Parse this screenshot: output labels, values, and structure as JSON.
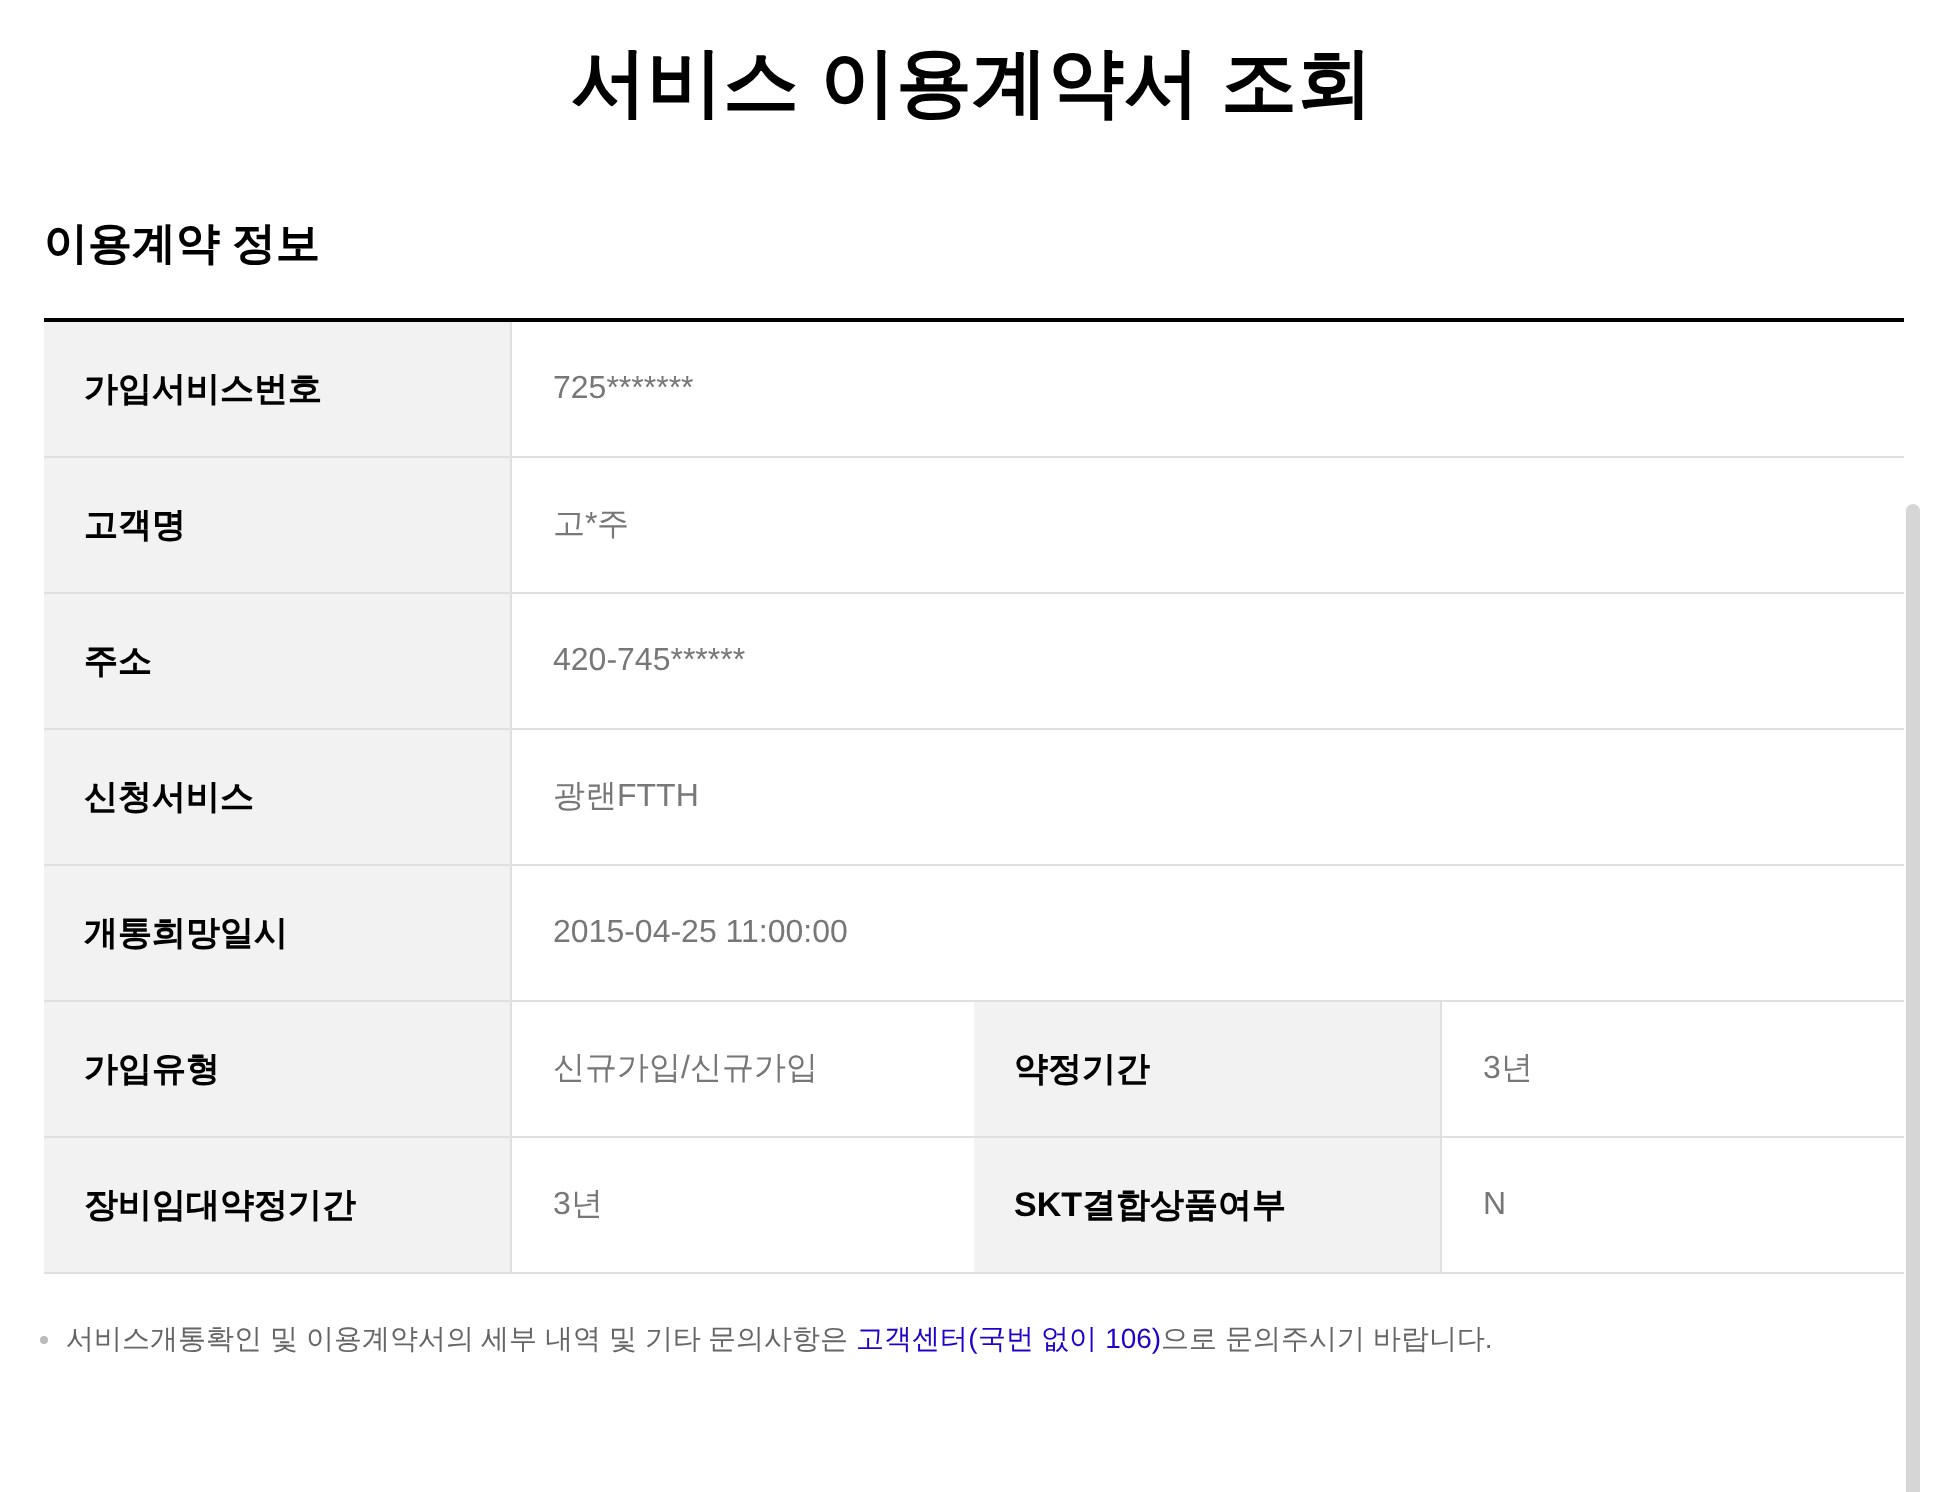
{
  "page_title": "서비스 이용계약서 조회",
  "section_title": "이용계약 정보",
  "table": {
    "rows": [
      {
        "cells": [
          {
            "label": "가입서비스번호",
            "value": "725*******"
          }
        ]
      },
      {
        "cells": [
          {
            "label": "고객명",
            "value": "고*주"
          }
        ]
      },
      {
        "cells": [
          {
            "label": "주소",
            "value": "420-745******"
          }
        ]
      },
      {
        "cells": [
          {
            "label": "신청서비스",
            "value": "광랜FTTH"
          }
        ]
      },
      {
        "cells": [
          {
            "label": "개통희망일시",
            "value": "2015-04-25 11:00:00"
          }
        ]
      },
      {
        "cells": [
          {
            "label": "가입유형",
            "value": "신규가입/신규가입"
          },
          {
            "label": "약정기간",
            "value": "3년"
          }
        ]
      },
      {
        "cells": [
          {
            "label": "장비임대약정기간",
            "value": "3년"
          },
          {
            "label": "SKT결합상품여부",
            "value": "N"
          }
        ]
      }
    ]
  },
  "note": {
    "before": "서비스개통확인 및 이용계약서의 세부 내역 및 기타 문의사항은",
    "link": "고객센터(국번 없이 106)",
    "after": "으로 문의주시기 바랍니다."
  }
}
